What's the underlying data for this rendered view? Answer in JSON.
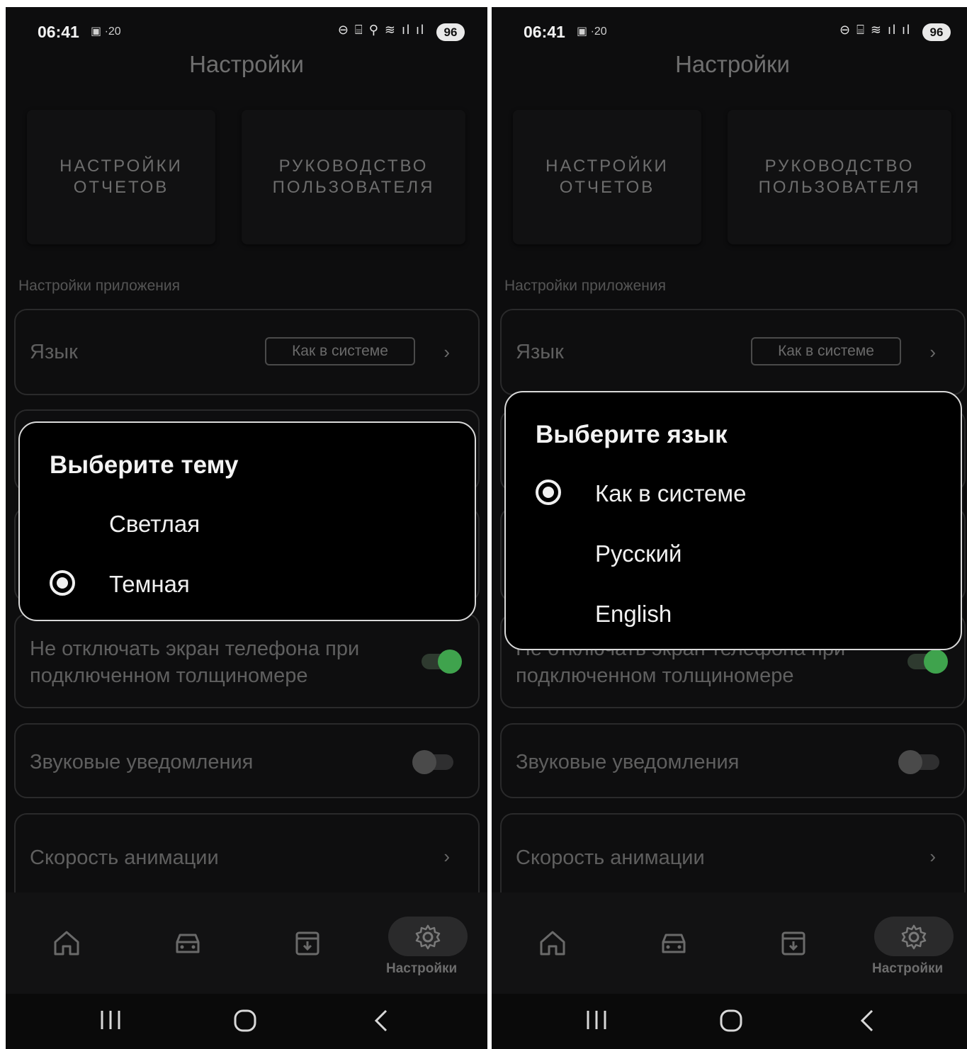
{
  "status": {
    "time": "06:41",
    "left_icons": "▣ ·20",
    "battery": "96"
  },
  "screen": {
    "title": "Настройки",
    "cards": {
      "reports": "НАСТРОЙКИ ОТЧЕТОВ",
      "manual": "РУКОВОДСТВО ПОЛЬЗОВАТЕЛЯ"
    },
    "section_label": "Настройки приложения",
    "language_row": {
      "label": "Язык",
      "value": "Как в системе"
    },
    "keep_screen_row": {
      "label": "Не отключать экран телефона при подключенном толщиномере",
      "enabled": true
    },
    "sound_row": {
      "label": "Звуковые уведомления",
      "enabled": false
    },
    "animation_row": {
      "label": "Скорость анимации"
    }
  },
  "nav": {
    "items": [
      "home-icon",
      "car-icon",
      "archive-icon",
      "gear-icon"
    ],
    "active_label": "Настройки"
  },
  "theme_dialog": {
    "title": "Выберите тему",
    "options": [
      "Светлая",
      "Темная"
    ],
    "selected": "Темная"
  },
  "language_dialog": {
    "title": "Выберите язык",
    "options": [
      "Как в системе",
      "Русский",
      "English"
    ],
    "selected": "Как в системе"
  },
  "colors": {
    "accent_green": "#3fa34d",
    "background": "#0d0d0e",
    "dialog_border": "#d9d9d9"
  }
}
